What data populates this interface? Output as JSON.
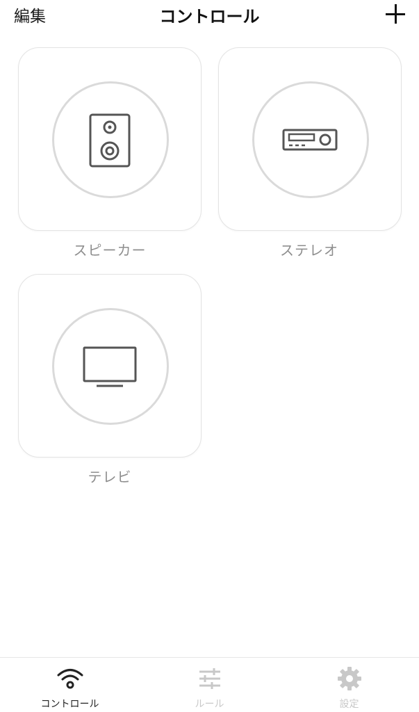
{
  "header": {
    "edit_label": "編集",
    "title": "コントロール",
    "add_icon": "plus-icon"
  },
  "devices": [
    {
      "label": "スピーカー",
      "icon": "speaker-icon"
    },
    {
      "label": "ステレオ",
      "icon": "stereo-receiver-icon"
    },
    {
      "label": "テレビ",
      "icon": "tv-icon"
    }
  ],
  "tabbar": {
    "tabs": [
      {
        "label": "コントロール",
        "icon": "wifi-icon",
        "active": true
      },
      {
        "label": "ルール",
        "icon": "sliders-icon",
        "active": false
      },
      {
        "label": "設定",
        "icon": "gear-icon",
        "active": false
      }
    ]
  },
  "colors": {
    "icon_stroke": "#555555",
    "circle_stroke": "#dadada",
    "label_gray": "#8e8e8e",
    "tab_active": "#222222",
    "tab_inactive": "#c8c8c8"
  }
}
